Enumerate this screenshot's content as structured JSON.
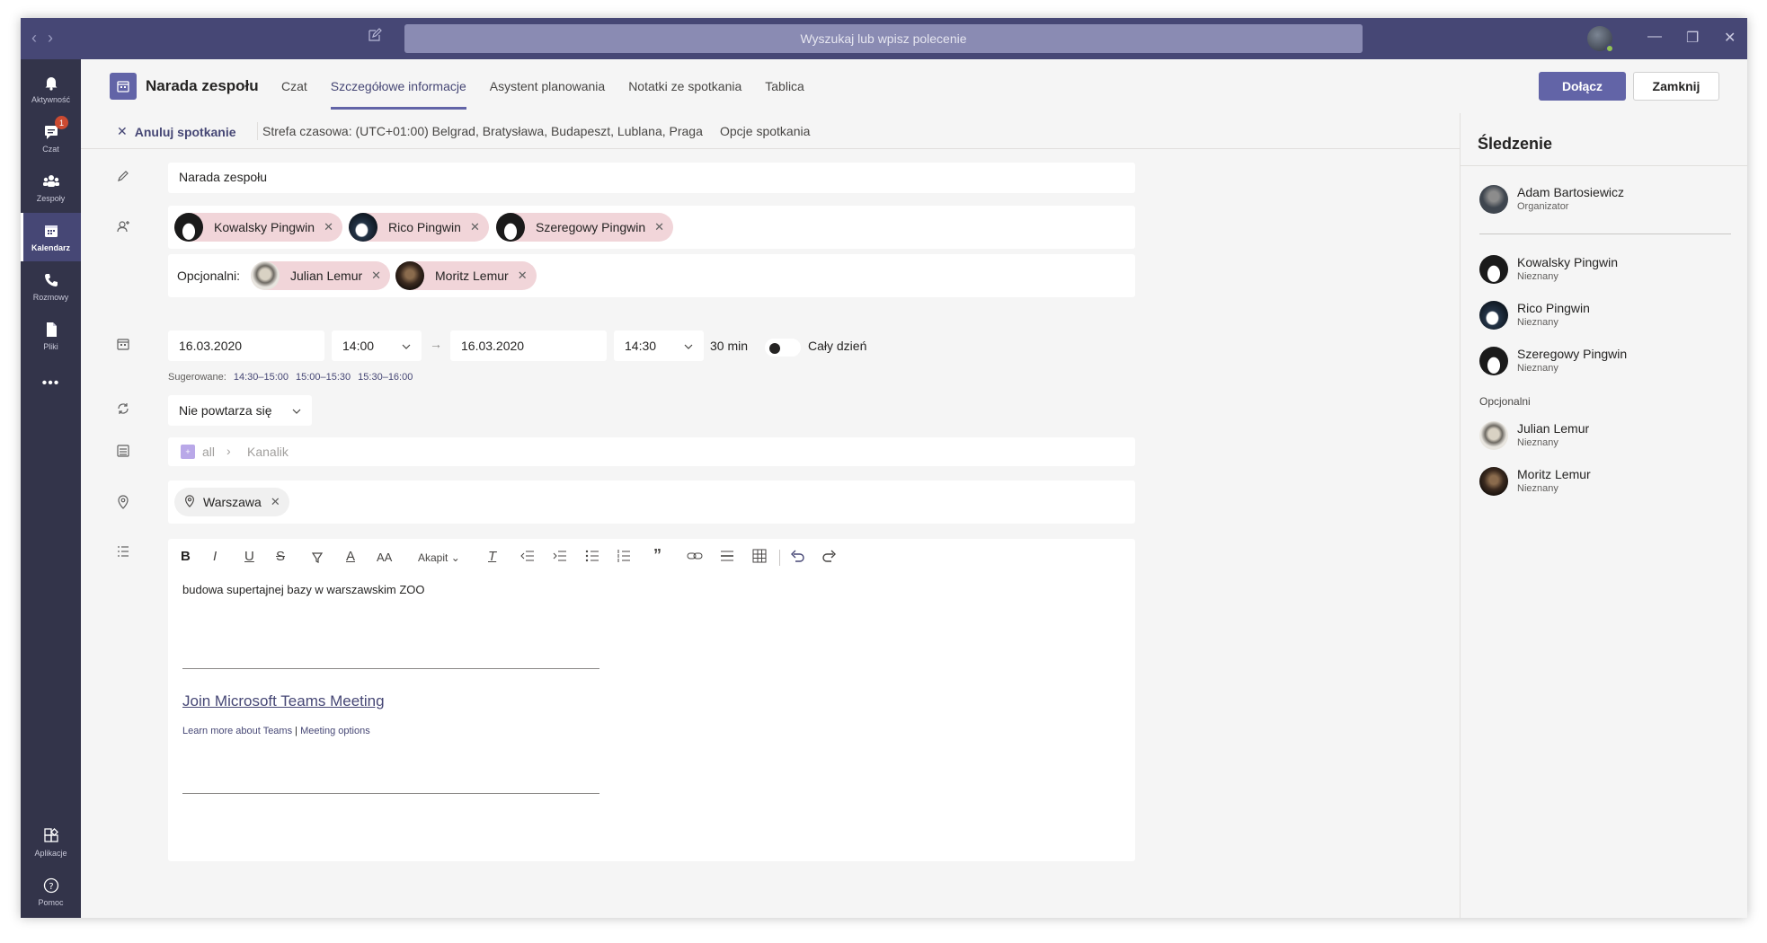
{
  "titlebar": {
    "search_placeholder": "Wyszukaj lub wpisz polecenie"
  },
  "rail": {
    "items": [
      {
        "label": "Aktywność",
        "icon": "bell-icon"
      },
      {
        "label": "Czat",
        "icon": "chat-icon",
        "badge": "1"
      },
      {
        "label": "Zespoły",
        "icon": "teams-icon"
      },
      {
        "label": "Kalendarz",
        "icon": "calendar-icon",
        "active": true
      },
      {
        "label": "Rozmowy",
        "icon": "phone-icon"
      },
      {
        "label": "Pliki",
        "icon": "files-icon"
      },
      {
        "label": "Aplikacje",
        "icon": "apps-icon"
      },
      {
        "label": "Pomoc",
        "icon": "help-icon"
      }
    ]
  },
  "header": {
    "title": "Narada zespołu",
    "tabs": [
      "Czat",
      "Szczegółowe informacje",
      "Asystent planowania",
      "Notatki ze spotkania",
      "Tablica"
    ],
    "join_label": "Dołącz",
    "close_label": "Zamknij"
  },
  "subbar": {
    "cancel_label": "Anuluj spotkanie",
    "timezone": "Strefa czasowa: (UTC+01:00) Belgrad, Bratysława, Budapeszt, Lublana, Praga",
    "options_label": "Opcje spotkania"
  },
  "form": {
    "title_value": "Narada zespołu",
    "required": [
      "Kowalsky Pingwin",
      "Rico Pingwin",
      "Szeregowy Pingwin"
    ],
    "optional_label": "Opcjonalni:",
    "optional": [
      "Julian Lemur",
      "Moritz Lemur"
    ],
    "start_date": "16.03.2020",
    "start_time": "14:00",
    "end_date": "16.03.2020",
    "end_time": "14:30",
    "duration": "30 min",
    "allday_label": "Cały dzień",
    "suggested_label": "Sugerowane:",
    "suggested": [
      "14:30–15:00",
      "15:00–15:30",
      "15:30–16:00"
    ],
    "repeat": "Nie powtarza się",
    "channel_team": "all",
    "channel_name": "Kanalik",
    "location": "Warszawa"
  },
  "editor": {
    "paragraph_label": "Akapit",
    "body": "budowa supertajnej bazy w warszawskim ZOO",
    "join_link": "Join Microsoft Teams Meeting",
    "learn_more": "Learn more about Teams",
    "pipe": "|",
    "meeting_options": "Meeting options"
  },
  "tracking": {
    "title": "Śledzenie",
    "organizer": {
      "name": "Adam Bartosiewicz",
      "status": "Organizator"
    },
    "required": [
      {
        "name": "Kowalsky Pingwin",
        "status": "Nieznany"
      },
      {
        "name": "Rico Pingwin",
        "status": "Nieznany"
      },
      {
        "name": "Szeregowy Pingwin",
        "status": "Nieznany"
      }
    ],
    "optional_label": "Opcjonalni",
    "optional": [
      {
        "name": "Julian Lemur",
        "status": "Nieznany"
      },
      {
        "name": "Moritz Lemur",
        "status": "Nieznany"
      }
    ]
  },
  "colors": {
    "brand": "#6264a7",
    "titlebar": "#464775",
    "rail": "#33344a",
    "chip": "#f1d5d9"
  }
}
